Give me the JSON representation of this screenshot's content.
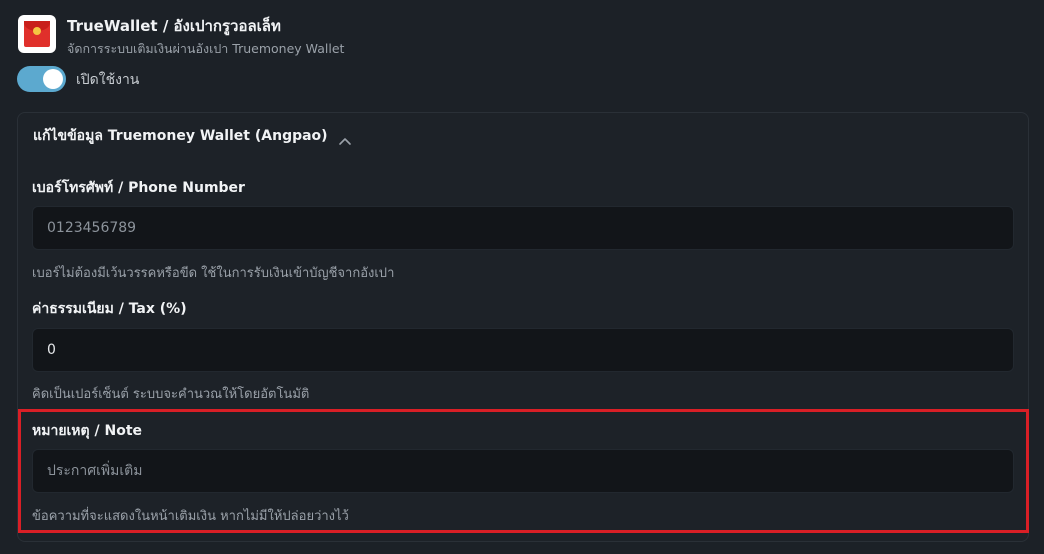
{
  "header": {
    "title": "TrueWallet / อังเปากรูวอลเล็ท",
    "subtitle": "จัดการระบบเติมเงินผ่านอังเปา Truemoney Wallet",
    "icon": "red-envelope-icon"
  },
  "toggle": {
    "label": "เปิดใช้งาน",
    "enabled": true,
    "color": "#5ca9cf"
  },
  "panel": {
    "title": "แก้ไขข้อมูล Truemoney Wallet (Angpao)",
    "expanded": true
  },
  "fields": {
    "phone": {
      "label": "เบอร์โทรศัพท์ / Phone Number",
      "placeholder": "0123456789",
      "value": "",
      "hint": "เบอร์ไม่ต้องมีเว้นวรรคหรือขีด ใช้ในการรับเงินเข้าบัญชีจากอังเปา"
    },
    "tax": {
      "label": "ค่าธรรมเนียม / Tax (%)",
      "value": "0",
      "hint": "คิดเป็นเปอร์เซ็นต์ ระบบจะคำนวณให้โดยอัตโนมัติ"
    },
    "note": {
      "label": "หมายเหตุ / Note",
      "placeholder": "ประกาศเพิ่มเติม",
      "value": "",
      "hint": "ข้อความที่จะแสดงในหน้าเติมเงิน หากไม่มีให้ปล่อยว่างไว้"
    }
  },
  "highlight_color": "#d91f26"
}
